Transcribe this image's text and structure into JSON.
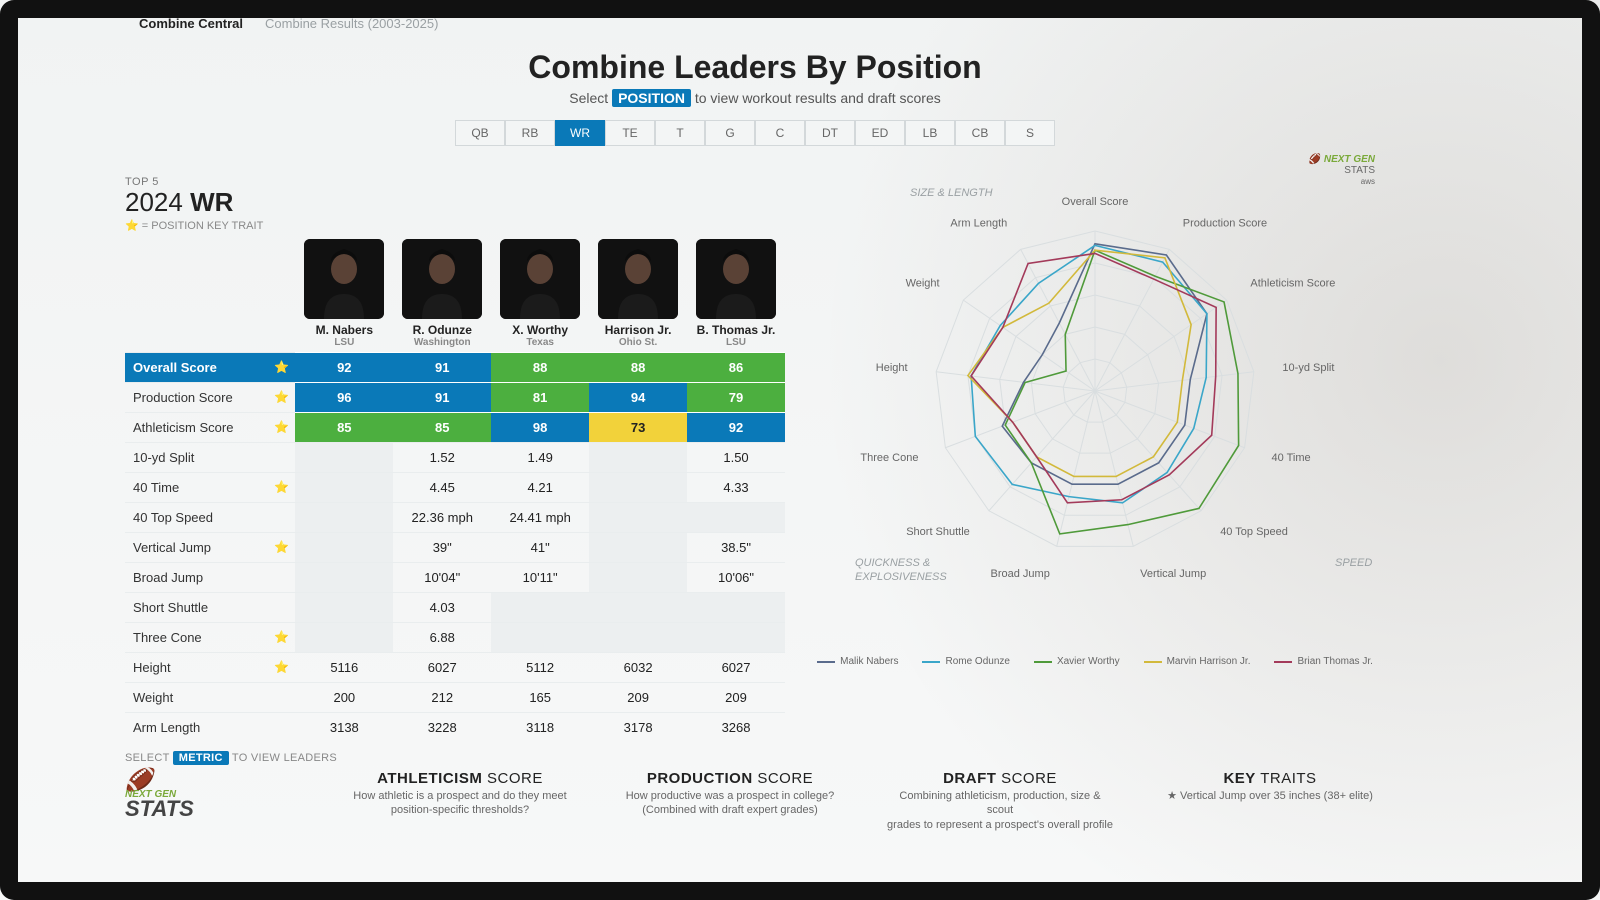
{
  "tabs": {
    "active": "Combine Central",
    "other": "Combine Results (2003-2025)"
  },
  "headline": "Combine Leaders By Position",
  "subhead_pre": "Select ",
  "subhead_pill": "POSITION",
  "subhead_post": " to view workout results and draft scores",
  "positions": [
    "QB",
    "RB",
    "WR",
    "TE",
    "T",
    "G",
    "C",
    "DT",
    "ED",
    "LB",
    "CB",
    "S"
  ],
  "position_active": "WR",
  "top5_label": "TOP 5",
  "year": "2024",
  "pos_abbr": "WR",
  "legend_star": "⭐ = POSITION KEY TRAIT",
  "select_metric_pre": "SELECT ",
  "select_metric_pill": "METRIC",
  "select_metric_post": " TO VIEW LEADERS",
  "players": [
    {
      "name": "M. Nabers",
      "school": "LSU"
    },
    {
      "name": "R. Odunze",
      "school": "Washington"
    },
    {
      "name": "X. Worthy",
      "school": "Texas"
    },
    {
      "name": "Harrison Jr.",
      "school": "Ohio St."
    },
    {
      "name": "B. Thomas Jr.",
      "school": "LSU"
    }
  ],
  "rows": [
    {
      "label": "Overall Score",
      "star": true,
      "selected": true,
      "vals": [
        "92",
        "91",
        "88",
        "88",
        "86"
      ],
      "cls": [
        "c-blue",
        "c-blue",
        "c-green",
        "c-green",
        "c-green"
      ]
    },
    {
      "label": "Production Score",
      "star": true,
      "vals": [
        "96",
        "91",
        "81",
        "94",
        "79"
      ],
      "cls": [
        "c-blue",
        "c-blue",
        "c-green",
        "c-blue",
        "c-green"
      ]
    },
    {
      "label": "Athleticism Score",
      "star": true,
      "vals": [
        "85",
        "85",
        "98",
        "73",
        "92"
      ],
      "cls": [
        "c-green",
        "c-green",
        "c-blue",
        "c-yellow",
        "c-blue"
      ]
    },
    {
      "label": "10-yd Split",
      "vals": [
        "",
        "1.52",
        "1.49",
        "",
        "1.50"
      ],
      "cls": [
        "c-gray",
        "",
        "",
        "c-gray",
        ""
      ]
    },
    {
      "label": "40 Time",
      "star": true,
      "vals": [
        "",
        "4.45",
        "4.21",
        "",
        "4.33"
      ],
      "cls": [
        "c-gray",
        "",
        "",
        "c-gray",
        ""
      ]
    },
    {
      "label": "40 Top Speed",
      "vals": [
        "",
        "22.36 mph",
        "24.41 mph",
        "",
        ""
      ],
      "cls": [
        "c-gray",
        "",
        "",
        "c-gray",
        "c-gray"
      ]
    },
    {
      "label": "Vertical Jump",
      "star": true,
      "vals": [
        "",
        "39\"",
        "41\"",
        "",
        "38.5\""
      ],
      "cls": [
        "c-gray",
        "",
        "",
        "c-gray",
        ""
      ]
    },
    {
      "label": "Broad Jump",
      "vals": [
        "",
        "10'04\"",
        "10'11\"",
        "",
        "10'06\""
      ],
      "cls": [
        "c-gray",
        "",
        "",
        "c-gray",
        ""
      ]
    },
    {
      "label": "Short Shuttle",
      "vals": [
        "",
        "4.03",
        "",
        "",
        ""
      ],
      "cls": [
        "c-gray",
        "",
        "c-gray",
        "c-gray",
        "c-gray"
      ]
    },
    {
      "label": "Three Cone",
      "star": true,
      "vals": [
        "",
        "6.88",
        "",
        "",
        ""
      ],
      "cls": [
        "c-gray",
        "",
        "c-gray",
        "c-gray",
        "c-gray"
      ]
    },
    {
      "label": "Height",
      "star": true,
      "vals": [
        "5116",
        "6027",
        "5112",
        "6032",
        "6027"
      ]
    },
    {
      "label": "Weight",
      "vals": [
        "200",
        "212",
        "165",
        "209",
        "209"
      ]
    },
    {
      "label": "Arm Length",
      "vals": [
        "3138",
        "3228",
        "3118",
        "3178",
        "3268"
      ]
    }
  ],
  "chart_data": {
    "type": "radar",
    "axes": [
      "Overall Score",
      "Production Score",
      "Athleticism Score",
      "10-yd Split",
      "40 Time",
      "40 Top Speed",
      "Vertical Jump",
      "Broad Jump",
      "Short Shuttle",
      "Three Cone",
      "Height",
      "Weight",
      "Arm Length"
    ],
    "categories": {
      "SIZE & LENGTH": 0,
      "SPEED": 4,
      "QUICKNESS & EXPLOSIVENESS": 8
    },
    "range": [
      0,
      100
    ],
    "series": [
      {
        "name": "Malik Nabers",
        "color": "#5a6b8c",
        "values": [
          92,
          96,
          85,
          60,
          60,
          60,
          60,
          60,
          60,
          62,
          45,
          40,
          48
        ]
      },
      {
        "name": "Rome Odunze",
        "color": "#3aa6c9",
        "values": [
          91,
          91,
          85,
          70,
          66,
          68,
          72,
          68,
          78,
          80,
          78,
          72,
          76
        ]
      },
      {
        "name": "Xavier Worthy",
        "color": "#4f9a3a",
        "values": [
          88,
          81,
          98,
          90,
          96,
          98,
          86,
          92,
          60,
          60,
          44,
          22,
          40
        ]
      },
      {
        "name": "Marvin Harrison Jr.",
        "color": "#d2b93b",
        "values": [
          88,
          94,
          73,
          55,
          55,
          55,
          55,
          55,
          55,
          55,
          80,
          70,
          62
        ]
      },
      {
        "name": "Brian Thomas Jr.",
        "color": "#a33a5a",
        "values": [
          86,
          79,
          92,
          76,
          78,
          70,
          70,
          72,
          55,
          55,
          78,
          70,
          90
        ]
      }
    ]
  },
  "footer": {
    "logo_top": "NEXT GEN",
    "logo_bottom": "STATS",
    "cols": [
      {
        "h": "ATHLETICISM",
        "s": " SCORE",
        "p1": "How athletic is a prospect and do they meet",
        "p2": "position-specific thresholds?"
      },
      {
        "h": "PRODUCTION",
        "s": " SCORE",
        "p1": "How productive was a prospect in college?",
        "p2": "(Combined with draft expert grades)"
      },
      {
        "h": "DRAFT",
        "s": " SCORE",
        "p1": "Combining athleticism, production, size & scout",
        "p2": "grades to represent a prospect's overall profile"
      },
      {
        "h": "KEY",
        "s": " TRAITS",
        "p1": "★ Vertical Jump over 35 inches (38+ elite)",
        "p2": ""
      }
    ]
  }
}
